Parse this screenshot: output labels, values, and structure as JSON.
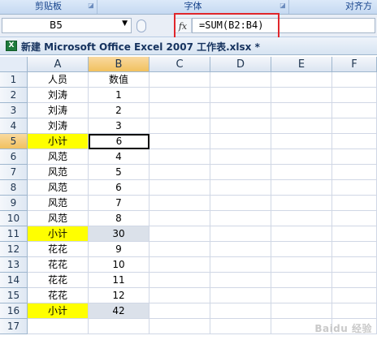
{
  "ribbon": {
    "groups": [
      {
        "label": "剪贴板"
      },
      {
        "label": "字体"
      },
      {
        "label": "对齐方"
      }
    ]
  },
  "formula_bar": {
    "name_box": "B5",
    "fx_label": "fx",
    "formula": "=SUM(B2:B4)"
  },
  "workbook": {
    "title": "新建 Microsoft Office Excel 2007 工作表.xlsx *"
  },
  "grid": {
    "columns": [
      "A",
      "B",
      "C",
      "D",
      "E",
      "F"
    ],
    "selected_column": "B",
    "selected_row": 5,
    "rows": [
      {
        "n": "1",
        "a": "人员",
        "b": "数值"
      },
      {
        "n": "2",
        "a": "刘涛",
        "b": "1"
      },
      {
        "n": "3",
        "a": "刘涛",
        "b": "2"
      },
      {
        "n": "4",
        "a": "刘涛",
        "b": "3"
      },
      {
        "n": "5",
        "a": "小计",
        "b": "6"
      },
      {
        "n": "6",
        "a": "风范",
        "b": "4"
      },
      {
        "n": "7",
        "a": "风范",
        "b": "5"
      },
      {
        "n": "8",
        "a": "风范",
        "b": "6"
      },
      {
        "n": "9",
        "a": "风范",
        "b": "7"
      },
      {
        "n": "10",
        "a": "风范",
        "b": "8"
      },
      {
        "n": "11",
        "a": "小计",
        "b": "30"
      },
      {
        "n": "12",
        "a": "花花",
        "b": "9"
      },
      {
        "n": "13",
        "a": "花花",
        "b": "10"
      },
      {
        "n": "14",
        "a": "花花",
        "b": "11"
      },
      {
        "n": "15",
        "a": "花花",
        "b": "12"
      },
      {
        "n": "16",
        "a": "小计",
        "b": "42"
      },
      {
        "n": "17",
        "a": "",
        "b": ""
      }
    ],
    "subtotal_color": "#ffff00"
  },
  "watermark": "Baidu 经验"
}
